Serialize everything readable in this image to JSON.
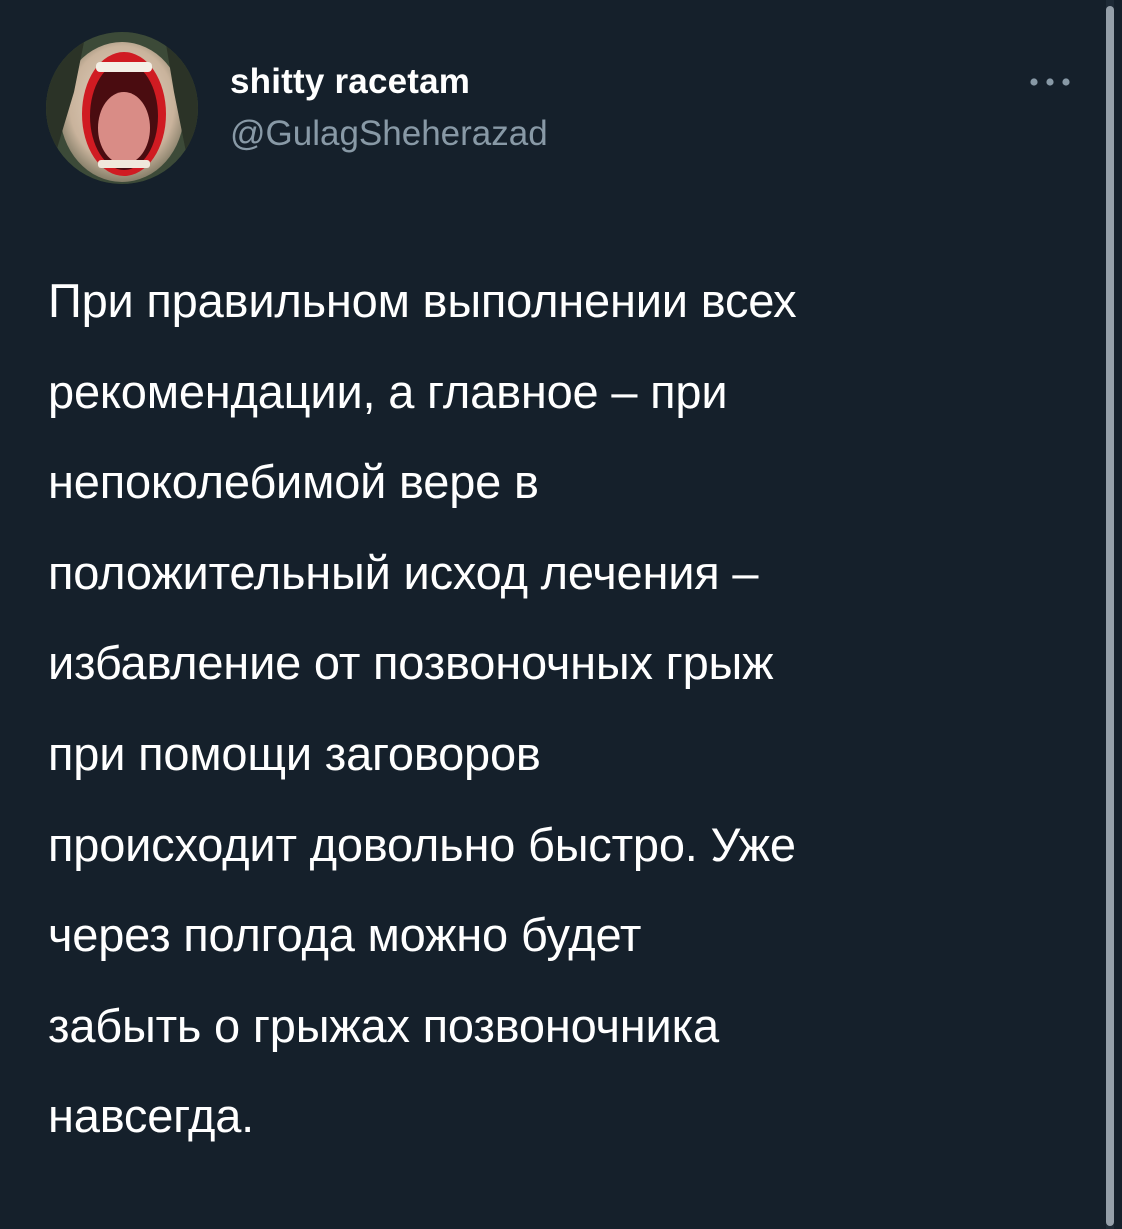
{
  "author": {
    "display_name": "shitty racetam",
    "handle": "@GulagSheherazad",
    "avatar": "screaming-mouth-avatar"
  },
  "tweet": {
    "text": "При правильном выполнении всех\nрекомендации, а главное – при\nнепоколебимой вере в\nположительный исход лечения –\nизбавление от позвоночных грыж\nпри помощи заговоров\nпроисходит довольно быстро. Уже\nчерез полгода можно будет\nзабыть о грыжах позвоночника\nнавсегда."
  },
  "icons": {
    "more": "more-horizontal-icon"
  },
  "colors": {
    "background": "#15202b",
    "primary_text": "#ffffff",
    "secondary_text": "#8899a6"
  }
}
